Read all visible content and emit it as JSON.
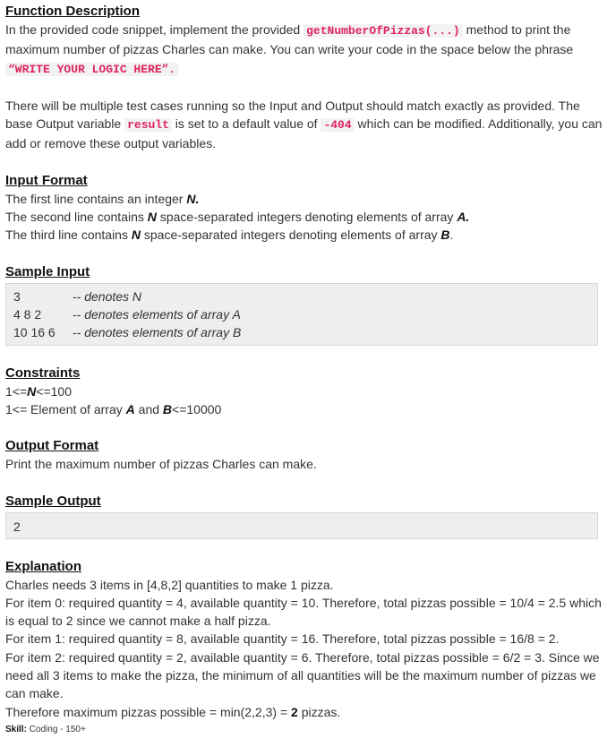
{
  "function_description": {
    "heading": "Function Description",
    "p1_a": "In the provided code snippet, implement the provided ",
    "p1_code": "getNumberOfPizzas(...)",
    "p1_b": " method to print the maximum number of pizzas Charles can make. You can write your code in the space below the phrase ",
    "p1_phrase": "“WRITE YOUR LOGIC HERE”.",
    "p2_a": "There will be multiple test cases running so the Input and Output should match exactly as provided. The base Output variable ",
    "p2_code": "result",
    "p2_b": " is set to a default value of ",
    "p2_default": "-404",
    "p2_c": " which can be modified. Additionally, you can add or remove these output variables."
  },
  "input_format": {
    "heading": "Input Format",
    "l1_a": "The first line contains an integer ",
    "l1_var": "N.",
    "l2_a": "The second line contains ",
    "l2_var": "N",
    "l2_b": " space-separated integers denoting elements of array ",
    "l2_arr": "A.",
    "l3_a": "The third line contains ",
    "l3_var": "N",
    "l3_b": " space-separated integers denoting elements of array ",
    "l3_arr": "B",
    "l3_end": "."
  },
  "sample_input": {
    "heading": "Sample Input",
    "rows": [
      {
        "value": "3",
        "comment": "-- denotes N"
      },
      {
        "value": "4 8 2",
        "comment": "-- denotes elements of array A"
      },
      {
        "value": "10 16 6",
        "comment": "-- denotes elements of array B"
      }
    ]
  },
  "constraints": {
    "heading": "Constraints",
    "l1_a": "1<=",
    "l1_var": "N",
    "l1_b": "<=100",
    "l2_a": "1<= Element of array ",
    "l2_var1": "A",
    "l2_mid": " and ",
    "l2_var2": "B",
    "l2_b": "<=10000"
  },
  "output_format": {
    "heading": "Output Format",
    "text": "Print the maximum number of pizzas Charles can make."
  },
  "sample_output": {
    "heading": "Sample Output",
    "value": "2"
  },
  "explanation": {
    "heading": "Explanation",
    "intro": "Charles needs 3 items in [4,8,2] quantities to make 1 pizza.",
    "item0": "For item 0: required quantity = 4, available quantity = 10. Therefore, total pizzas possible = 10/4 = 2.5 which is equal to 2 since we cannot make a half pizza.",
    "item1": "For item 1: required quantity = 8, available quantity = 16. Therefore, total pizzas possible = 16/8 = 2.",
    "item2": "For item 2: required quantity = 2, available quantity = 6. Therefore, total pizzas possible = 6/2 = 3. Since we need all 3 items to make the pizza, the minimum of all quantities will be the maximum number of pizzas we can make.",
    "final_a": "Therefore maximum pizzas possible = min(2,2,3) = ",
    "final_value": "2",
    "final_b": " pizzas."
  },
  "skill": {
    "label": "Skill:",
    "value": " Coding - 150+"
  }
}
